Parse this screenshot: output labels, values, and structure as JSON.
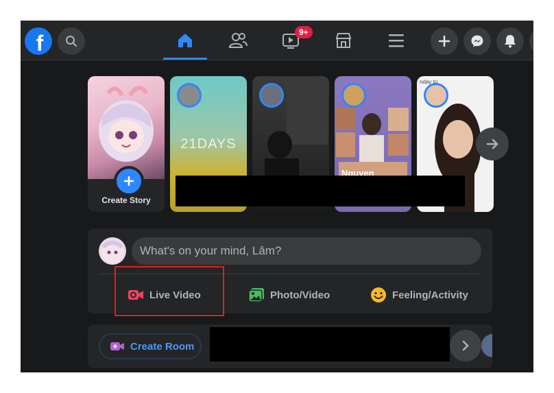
{
  "topbar": {
    "logo_letter": "f",
    "notifications_badge": "9+"
  },
  "stories": {
    "create_label": "Create Story",
    "card2_text": "21DAYS",
    "card5_text": "nday to",
    "card4_name": "Nguyen"
  },
  "composer": {
    "placeholder": "What's on your mind, Lâm?",
    "live_label": "Live Video",
    "photo_label": "Photo/Video",
    "feeling_label": "Feeling/Activity"
  },
  "rooms": {
    "create_label": "Create Room"
  },
  "colors": {
    "accent": "#2d88ff",
    "live_red": "#f3425f",
    "photo_green": "#45bd62",
    "feeling_yellow": "#f7b928",
    "room_purple": "#b35fdb"
  }
}
